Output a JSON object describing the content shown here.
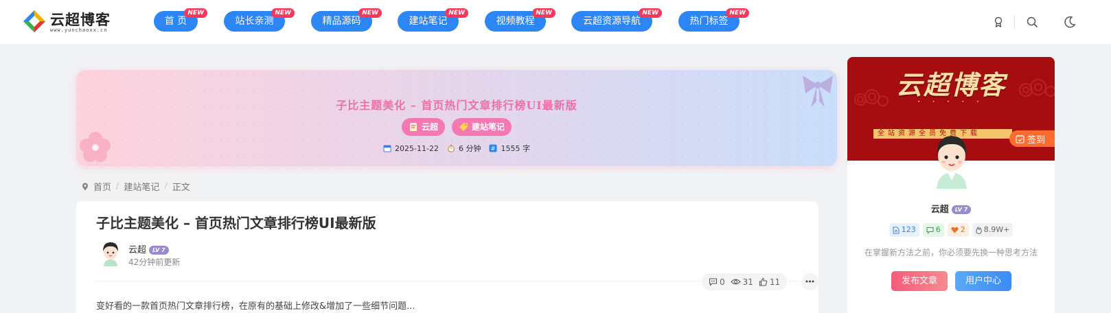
{
  "header": {
    "logo_text": "云超博客",
    "logo_sub": "www.yunchaoxx.cn",
    "nav": [
      {
        "label": "首 页",
        "badge": "NEW"
      },
      {
        "label": "站长亲测",
        "badge": "NEW"
      },
      {
        "label": "精品源码",
        "badge": "NEW"
      },
      {
        "label": "建站笔记",
        "badge": "NEW"
      },
      {
        "label": "视频教程",
        "badge": "NEW"
      },
      {
        "label": "云超资源导航",
        "badge": "NEW"
      },
      {
        "label": "热门标签",
        "badge": "NEW"
      }
    ],
    "icons": [
      "medal-icon",
      "search-icon",
      "moon-icon"
    ]
  },
  "hero": {
    "title": "子比主题美化 – 首页热门文章排行榜UI最新版",
    "tags": [
      {
        "label": "云超",
        "icon": "note-icon"
      },
      {
        "label": "建站笔记",
        "icon": "tag-icon"
      }
    ],
    "date": "2025-11-22",
    "read_time": "6 分钟",
    "word_count": "1555 字"
  },
  "breadcrumb": [
    "首页",
    "建站笔记",
    "正文"
  ],
  "article": {
    "title": "子比主题美化 – 首页热门文章排行榜UI最新版",
    "author": "云超",
    "level": "LV 7",
    "updated": "42分钟前更新",
    "comments": "0",
    "views": "31",
    "likes": "11",
    "excerpt": "变好看的一款首页热门文章排行榜，在原有的基础上修改&增加了一些细节问题..."
  },
  "sidebar": {
    "banner_title": "云超博客",
    "banner_dots": "• • • • •",
    "banner_strip": "全站资源全员免费下载",
    "checkin": "签到",
    "name": "云超",
    "level": "LV 7",
    "stats": {
      "posts": "123",
      "comments": "6",
      "likes": "2",
      "views": "8.9W+"
    },
    "motto": "在掌握新方法之前，你必须要先换一种思考方法",
    "btn_publish": "发布文章",
    "btn_user": "用户中心"
  },
  "colors": {
    "nav_blue": "#2d86f5",
    "new_badge": "#f5385c",
    "hero_pink": "#f06fa6",
    "banner_red": "#a60d10",
    "checkin_orange": "#ff6b2c",
    "btn_publish": "#f46c7f",
    "btn_user": "#3b95f5"
  }
}
